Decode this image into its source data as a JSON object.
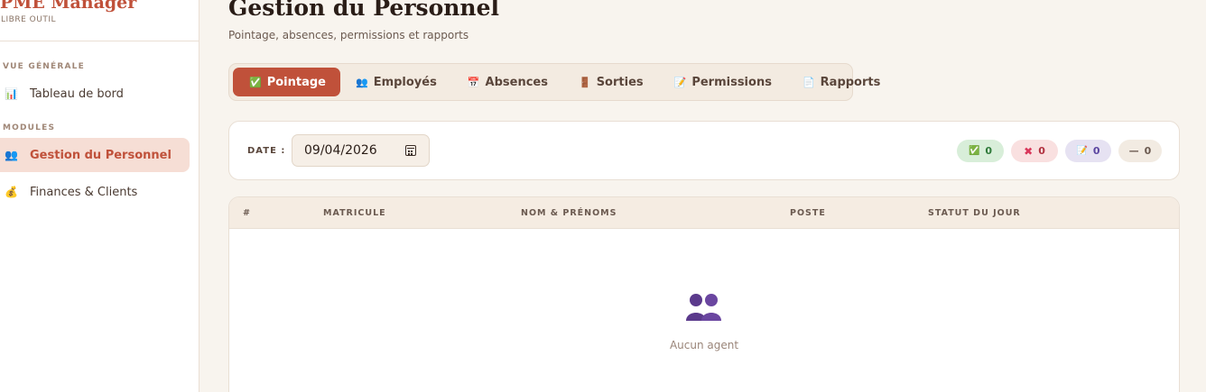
{
  "sidebar": {
    "brand": "PME Manager",
    "brand_sub": "LIBRE OUTIL",
    "sections": [
      "VUE GÉNÉRALE",
      "MODULES"
    ],
    "items": [
      {
        "label": "Tableau de bord",
        "icon": "bar-chart-icon",
        "glyph": "📊"
      },
      {
        "label": "Gestion du Personnel",
        "icon": "people-icon",
        "glyph": "👥"
      },
      {
        "label": "Finances & Clients",
        "icon": "money-bag-icon",
        "glyph": "💰"
      }
    ]
  },
  "header": {
    "title": "Gestion du Personnel",
    "subtitle": "Pointage, absences, permissions et rapports"
  },
  "tabs": [
    {
      "label": "Pointage",
      "icon": "check-box-icon",
      "glyph": "✅"
    },
    {
      "label": "Employés",
      "icon": "people-icon",
      "glyph": "👥"
    },
    {
      "label": "Absences",
      "icon": "calendar-icon",
      "glyph": "📅"
    },
    {
      "label": "Sorties",
      "icon": "door-icon",
      "glyph": "🚪"
    },
    {
      "label": "Permissions",
      "icon": "memo-icon",
      "glyph": "📝"
    },
    {
      "label": "Rapports",
      "icon": "document-icon",
      "glyph": "📄"
    }
  ],
  "date_filter": {
    "label": "DATE :",
    "value": "09/04/2026"
  },
  "summary": {
    "present": {
      "glyph": "✅",
      "count": "0"
    },
    "absent": {
      "glyph": "✖",
      "count": "0"
    },
    "permission": {
      "glyph": "📝",
      "count": "0"
    },
    "none": {
      "glyph": "—",
      "count": "0"
    }
  },
  "table": {
    "columns": [
      "#",
      "MATRICULE",
      "NOM & PRÉNOMS",
      "POSTE",
      "STATUT DU JOUR"
    ],
    "empty_text": "Aucun agent"
  },
  "colors": {
    "accent": "#c0513a",
    "background": "#f8f4ee",
    "active_item_bg": "#f6ded5"
  }
}
